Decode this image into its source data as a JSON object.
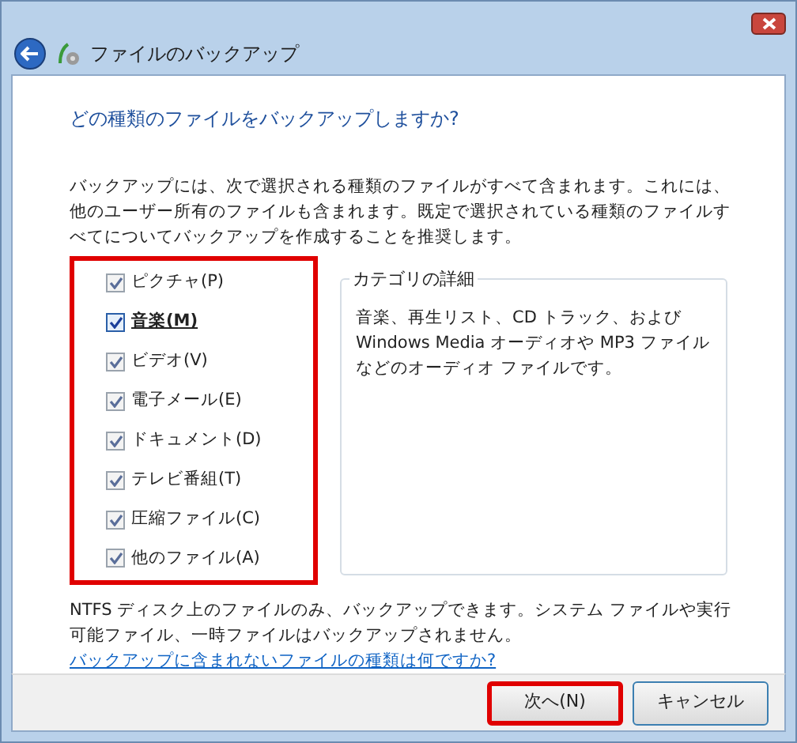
{
  "window": {
    "title": "ファイルのバックアップ"
  },
  "heading": "どの種類のファイルをバックアップしますか?",
  "intro": "バックアップには、次で選択される種類のファイルがすべて含まれます。これには、他のユーザー所有のファイルも含まれます。既定で選択されている種類のファイルすべてについてバックアップを作成することを推奨します。",
  "categories_highlighted": true,
  "categories": [
    {
      "label": "ピクチャ(P)",
      "checked": true,
      "selected": false
    },
    {
      "label": "音楽(M)",
      "checked": true,
      "selected": true
    },
    {
      "label": "ビデオ(V)",
      "checked": true,
      "selected": false
    },
    {
      "label": "電子メール(E)",
      "checked": true,
      "selected": false
    },
    {
      "label": "ドキュメント(D)",
      "checked": true,
      "selected": false
    },
    {
      "label": "テレビ番組(T)",
      "checked": true,
      "selected": false
    },
    {
      "label": "圧縮ファイル(C)",
      "checked": true,
      "selected": false
    },
    {
      "label": "他のファイル(A)",
      "checked": true,
      "selected": false
    }
  ],
  "details": {
    "title": "カテゴリの詳細",
    "text": "音楽、再生リスト、CD トラック、および Windows Media オーディオや MP3 ファイルなどのオーディオ ファイルです。"
  },
  "note": "NTFS ディスク上のファイルのみ、バックアップできます。システム ファイルや実行可能ファイル、一時ファイルはバックアップされません。",
  "note_link": "バックアップに含まれないファイルの種類は何ですか?",
  "buttons": [
    {
      "label": "次へ(N)",
      "highlighted": true
    },
    {
      "label": "キャンセル",
      "highlighted": false
    }
  ]
}
